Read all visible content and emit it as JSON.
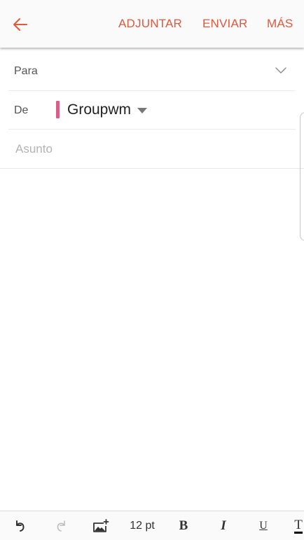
{
  "header": {
    "attach_label": "ADJUNTAR",
    "send_label": "ENVIAR",
    "more_label": "MÁS"
  },
  "compose": {
    "to_label": "Para",
    "from_label": "De",
    "from_account": "Groupwm",
    "subject_placeholder": "Asunto"
  },
  "toolbar": {
    "font_size": "12 pt",
    "bold_label": "B",
    "italic_label": "I",
    "underline_label": "U",
    "text_color_label": "T"
  },
  "colors": {
    "accent": "#e0583e",
    "account_marker": "#d95f88"
  },
  "icons": {
    "back": "arrow-left-icon",
    "expand_recipients": "chevron-down-icon",
    "account_dropdown": "dropdown-triangle-icon",
    "undo": "undo-icon",
    "redo": "redo-icon",
    "insert_image": "insert-image-icon"
  }
}
